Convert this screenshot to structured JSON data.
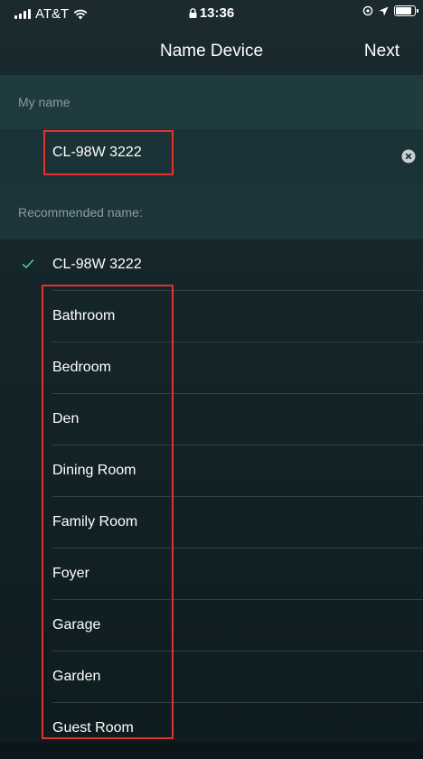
{
  "status_bar": {
    "carrier": "AT&T",
    "time": "13:36",
    "icons": [
      "signal-icon",
      "wifi-icon",
      "lock-icon",
      "alarm-icon",
      "location-icon",
      "battery-icon"
    ],
    "battery_level": 0.9
  },
  "nav": {
    "title": "Name Device",
    "next_label": "Next"
  },
  "my_name": {
    "header": "My name",
    "value": "CL-98W 3222"
  },
  "recommended": {
    "header": "Recommended name:",
    "items": [
      {
        "label": "CL-98W 3222",
        "selected": true
      },
      {
        "label": "Bathroom",
        "selected": false
      },
      {
        "label": "Bedroom",
        "selected": false
      },
      {
        "label": "Den",
        "selected": false
      },
      {
        "label": "Dining Room",
        "selected": false
      },
      {
        "label": "Family Room",
        "selected": false
      },
      {
        "label": "Foyer",
        "selected": false
      },
      {
        "label": "Garage",
        "selected": false
      },
      {
        "label": "Garden",
        "selected": false
      },
      {
        "label": "Guest Room",
        "selected": false
      }
    ]
  },
  "colors": {
    "highlight": "#e5312c",
    "check": "#3fcf8e"
  }
}
